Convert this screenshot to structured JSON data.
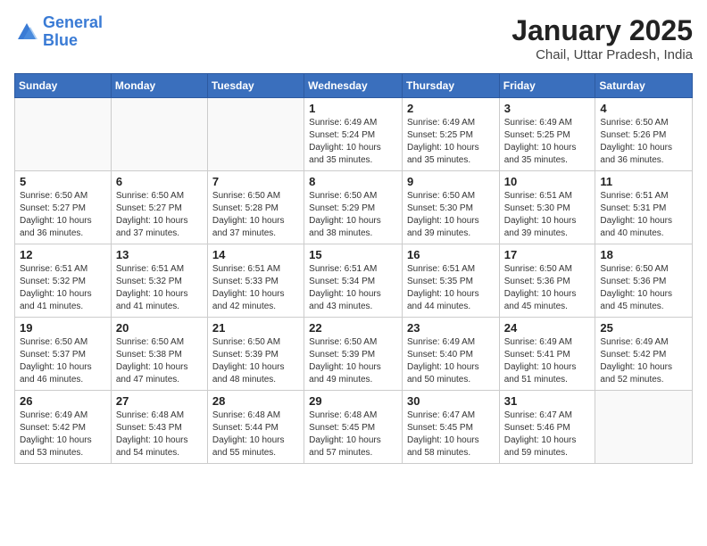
{
  "logo": {
    "line1": "General",
    "line2": "Blue"
  },
  "title": "January 2025",
  "subtitle": "Chail, Uttar Pradesh, India",
  "days_of_week": [
    "Sunday",
    "Monday",
    "Tuesday",
    "Wednesday",
    "Thursday",
    "Friday",
    "Saturday"
  ],
  "weeks": [
    [
      {
        "num": "",
        "info": ""
      },
      {
        "num": "",
        "info": ""
      },
      {
        "num": "",
        "info": ""
      },
      {
        "num": "1",
        "info": "Sunrise: 6:49 AM\nSunset: 5:24 PM\nDaylight: 10 hours\nand 35 minutes."
      },
      {
        "num": "2",
        "info": "Sunrise: 6:49 AM\nSunset: 5:25 PM\nDaylight: 10 hours\nand 35 minutes."
      },
      {
        "num": "3",
        "info": "Sunrise: 6:49 AM\nSunset: 5:25 PM\nDaylight: 10 hours\nand 35 minutes."
      },
      {
        "num": "4",
        "info": "Sunrise: 6:50 AM\nSunset: 5:26 PM\nDaylight: 10 hours\nand 36 minutes."
      }
    ],
    [
      {
        "num": "5",
        "info": "Sunrise: 6:50 AM\nSunset: 5:27 PM\nDaylight: 10 hours\nand 36 minutes."
      },
      {
        "num": "6",
        "info": "Sunrise: 6:50 AM\nSunset: 5:27 PM\nDaylight: 10 hours\nand 37 minutes."
      },
      {
        "num": "7",
        "info": "Sunrise: 6:50 AM\nSunset: 5:28 PM\nDaylight: 10 hours\nand 37 minutes."
      },
      {
        "num": "8",
        "info": "Sunrise: 6:50 AM\nSunset: 5:29 PM\nDaylight: 10 hours\nand 38 minutes."
      },
      {
        "num": "9",
        "info": "Sunrise: 6:50 AM\nSunset: 5:30 PM\nDaylight: 10 hours\nand 39 minutes."
      },
      {
        "num": "10",
        "info": "Sunrise: 6:51 AM\nSunset: 5:30 PM\nDaylight: 10 hours\nand 39 minutes."
      },
      {
        "num": "11",
        "info": "Sunrise: 6:51 AM\nSunset: 5:31 PM\nDaylight: 10 hours\nand 40 minutes."
      }
    ],
    [
      {
        "num": "12",
        "info": "Sunrise: 6:51 AM\nSunset: 5:32 PM\nDaylight: 10 hours\nand 41 minutes."
      },
      {
        "num": "13",
        "info": "Sunrise: 6:51 AM\nSunset: 5:32 PM\nDaylight: 10 hours\nand 41 minutes."
      },
      {
        "num": "14",
        "info": "Sunrise: 6:51 AM\nSunset: 5:33 PM\nDaylight: 10 hours\nand 42 minutes."
      },
      {
        "num": "15",
        "info": "Sunrise: 6:51 AM\nSunset: 5:34 PM\nDaylight: 10 hours\nand 43 minutes."
      },
      {
        "num": "16",
        "info": "Sunrise: 6:51 AM\nSunset: 5:35 PM\nDaylight: 10 hours\nand 44 minutes."
      },
      {
        "num": "17",
        "info": "Sunrise: 6:50 AM\nSunset: 5:36 PM\nDaylight: 10 hours\nand 45 minutes."
      },
      {
        "num": "18",
        "info": "Sunrise: 6:50 AM\nSunset: 5:36 PM\nDaylight: 10 hours\nand 45 minutes."
      }
    ],
    [
      {
        "num": "19",
        "info": "Sunrise: 6:50 AM\nSunset: 5:37 PM\nDaylight: 10 hours\nand 46 minutes."
      },
      {
        "num": "20",
        "info": "Sunrise: 6:50 AM\nSunset: 5:38 PM\nDaylight: 10 hours\nand 47 minutes."
      },
      {
        "num": "21",
        "info": "Sunrise: 6:50 AM\nSunset: 5:39 PM\nDaylight: 10 hours\nand 48 minutes."
      },
      {
        "num": "22",
        "info": "Sunrise: 6:50 AM\nSunset: 5:39 PM\nDaylight: 10 hours\nand 49 minutes."
      },
      {
        "num": "23",
        "info": "Sunrise: 6:49 AM\nSunset: 5:40 PM\nDaylight: 10 hours\nand 50 minutes."
      },
      {
        "num": "24",
        "info": "Sunrise: 6:49 AM\nSunset: 5:41 PM\nDaylight: 10 hours\nand 51 minutes."
      },
      {
        "num": "25",
        "info": "Sunrise: 6:49 AM\nSunset: 5:42 PM\nDaylight: 10 hours\nand 52 minutes."
      }
    ],
    [
      {
        "num": "26",
        "info": "Sunrise: 6:49 AM\nSunset: 5:42 PM\nDaylight: 10 hours\nand 53 minutes."
      },
      {
        "num": "27",
        "info": "Sunrise: 6:48 AM\nSunset: 5:43 PM\nDaylight: 10 hours\nand 54 minutes."
      },
      {
        "num": "28",
        "info": "Sunrise: 6:48 AM\nSunset: 5:44 PM\nDaylight: 10 hours\nand 55 minutes."
      },
      {
        "num": "29",
        "info": "Sunrise: 6:48 AM\nSunset: 5:45 PM\nDaylight: 10 hours\nand 57 minutes."
      },
      {
        "num": "30",
        "info": "Sunrise: 6:47 AM\nSunset: 5:45 PM\nDaylight: 10 hours\nand 58 minutes."
      },
      {
        "num": "31",
        "info": "Sunrise: 6:47 AM\nSunset: 5:46 PM\nDaylight: 10 hours\nand 59 minutes."
      },
      {
        "num": "",
        "info": ""
      }
    ]
  ]
}
